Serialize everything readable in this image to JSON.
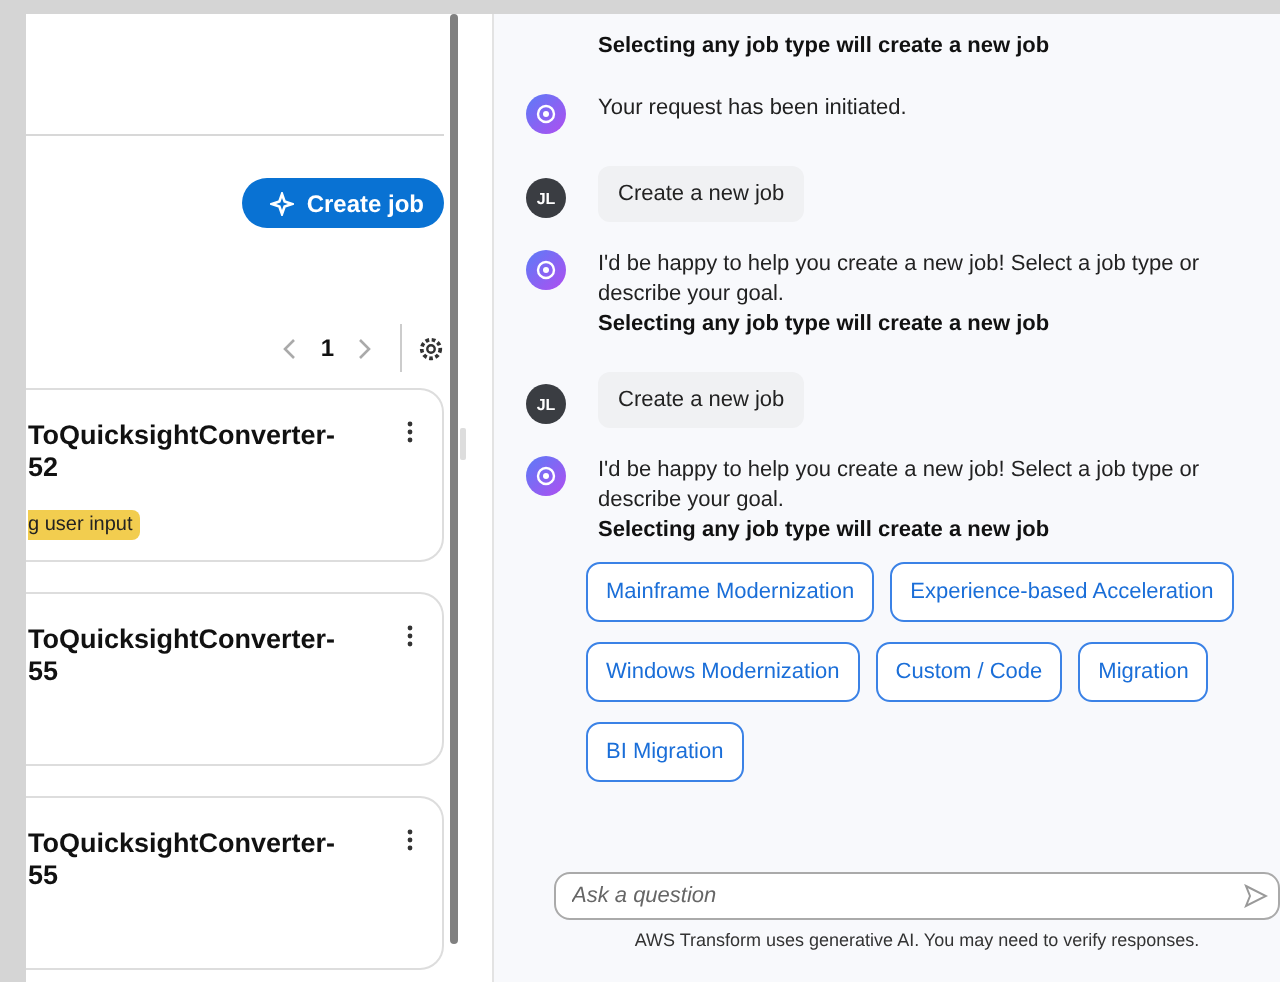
{
  "jobs_panel": {
    "create_button": "Create job",
    "pagination": {
      "page": "1"
    },
    "jobs": [
      {
        "title": "ToQuicksightConverter-52",
        "badge": "g user input"
      },
      {
        "title": "ToQuicksightConverter-55"
      },
      {
        "title": "ToQuicksightConverter-55"
      }
    ]
  },
  "chat": {
    "messages": [
      {
        "kind": "partial",
        "note": "Selecting any job type will create a new job"
      },
      {
        "kind": "bot",
        "text": "Your request has been initiated."
      },
      {
        "kind": "user",
        "initials": "JL",
        "text": "Create a new job"
      },
      {
        "kind": "bot",
        "text": "I'd be happy to help you create a new job! Select a job type or describe your goal.",
        "note": "Selecting any job type will create a new job"
      },
      {
        "kind": "user",
        "initials": "JL",
        "text": "Create a new job"
      },
      {
        "kind": "bot",
        "text": "I'd be happy to help you create a new job! Select a job type or describe your goal.",
        "note": "Selecting any job type will create a new job",
        "options": [
          "Mainframe Modernization",
          "Experience-based Acceleration",
          "Windows Modernization",
          "Custom / Code",
          "Migration",
          "BI Migration"
        ]
      }
    ],
    "input": {
      "placeholder": "Ask a question"
    },
    "disclaimer": "AWS Transform uses generative AI. You may need to verify responses."
  }
}
